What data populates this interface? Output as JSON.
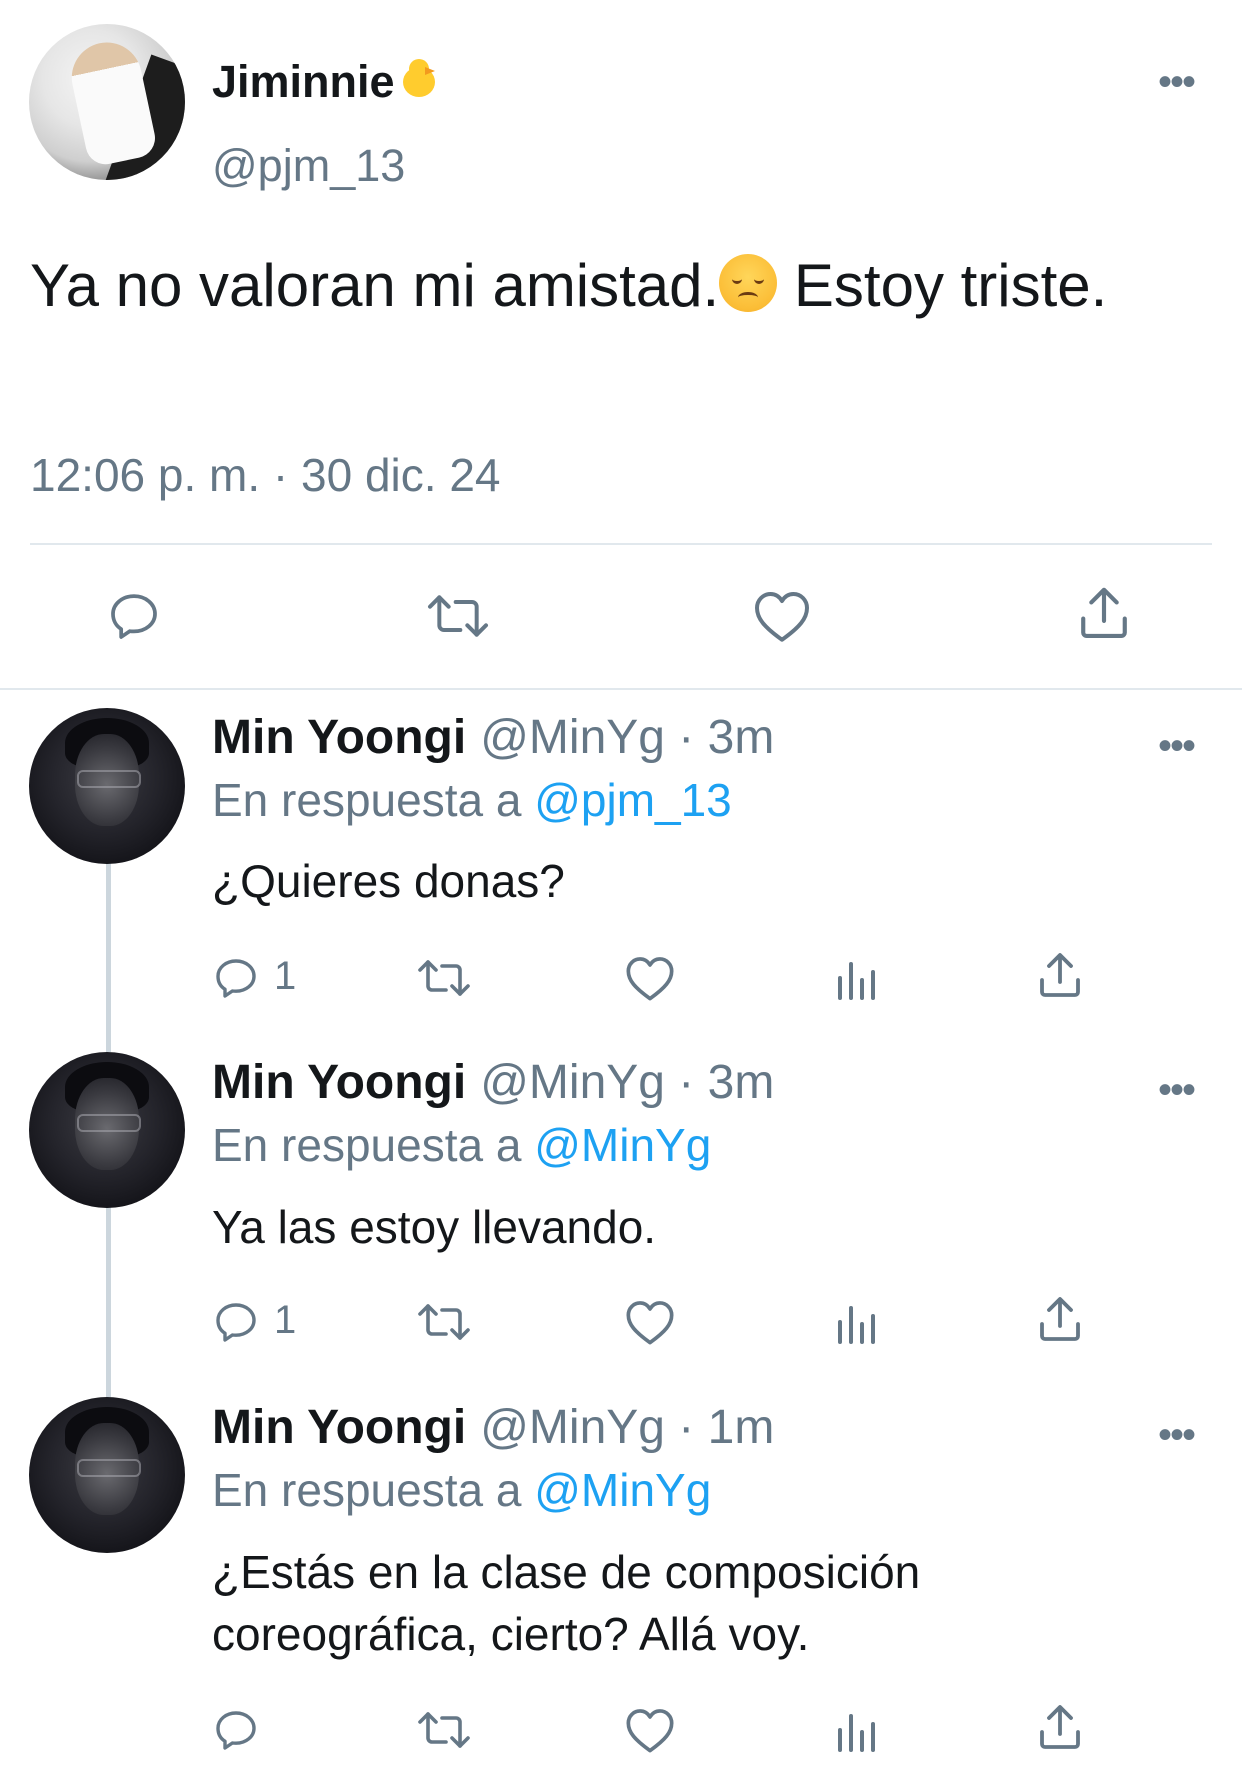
{
  "main_tweet": {
    "display_name": "Jiminnie",
    "name_emoji": "chick-emoji",
    "handle": "@pjm_13",
    "text_part1": "Ya no valoran mi amistad.",
    "text_emoji": "disappointed-face-emoji",
    "text_part2": " Estoy triste.",
    "timestamp": "12:06 p. m. · 30 dic. 24",
    "more_label": "•••",
    "actions": [
      "reply-icon",
      "retweet-icon",
      "like-icon",
      "share-icon"
    ]
  },
  "replies": [
    {
      "display_name": "Min Yoongi",
      "handle_time": "@MinYg · 3m",
      "reply_prefix": "En respuesta a ",
      "reply_to": "@pjm_13",
      "text": "¿Quieres donas?",
      "reply_count": "1",
      "more_label": "•••"
    },
    {
      "display_name": "Min Yoongi",
      "handle_time": "@MinYg · 3m",
      "reply_prefix": "En respuesta a ",
      "reply_to": "@MinYg",
      "text": "Ya las estoy llevando.",
      "reply_count": "1",
      "more_label": "•••"
    },
    {
      "display_name": "Min Yoongi",
      "handle_time": "@MinYg · 1m",
      "reply_prefix": "En respuesta a ",
      "reply_to": "@MinYg",
      "text": "¿Estás en la clase de composición coreográfica, cierto? Allá voy.",
      "reply_count": "",
      "more_label": "•••"
    }
  ],
  "colors": {
    "text": "#14171a",
    "secondary": "#657786",
    "link": "#1da1f2",
    "divider": "#e1e8ed",
    "thread_line": "#ccd6dd"
  }
}
